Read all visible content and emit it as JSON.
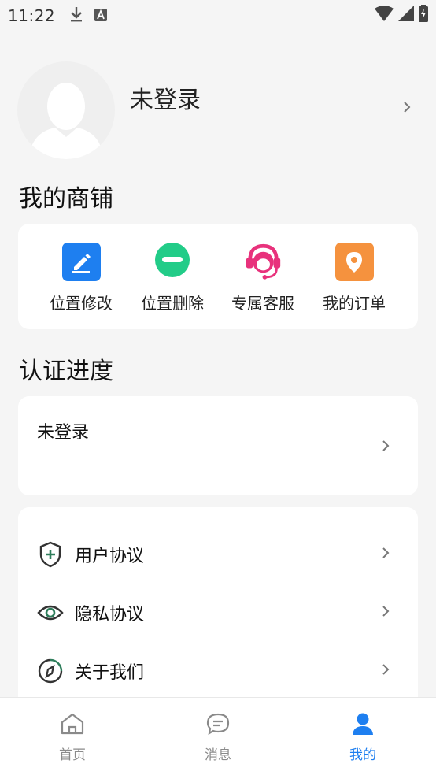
{
  "status_bar": {
    "time": "11:22"
  },
  "profile": {
    "name": "未登录"
  },
  "shop": {
    "title": "我的商铺",
    "items": [
      {
        "label": "位置修改",
        "icon": "edit-pen-icon",
        "color": "#1e7ff0"
      },
      {
        "label": "位置删除",
        "icon": "minus-circle-icon",
        "color": "#22cc88"
      },
      {
        "label": "专属客服",
        "icon": "customer-service-headset-icon",
        "color": "#e8327c"
      },
      {
        "label": "我的订单",
        "icon": "location-pin-icon",
        "color": "#f5923e"
      }
    ]
  },
  "auth": {
    "title": "认证进度",
    "status": "未登录"
  },
  "menu": {
    "items": [
      {
        "label": "用户协议",
        "icon": "shield-plus-icon"
      },
      {
        "label": "隐私协议",
        "icon": "eye-icon"
      },
      {
        "label": "关于我们",
        "icon": "compass-icon"
      }
    ]
  },
  "tabs": [
    {
      "label": "首页",
      "icon": "home-icon"
    },
    {
      "label": "消息",
      "icon": "message-bubble-icon"
    },
    {
      "label": "我的",
      "icon": "user-icon",
      "active": true
    }
  ],
  "colors": {
    "accent": "#1e7ff0",
    "inactive": "#8a8a8a",
    "menu_icon": "#2e7d5b"
  }
}
